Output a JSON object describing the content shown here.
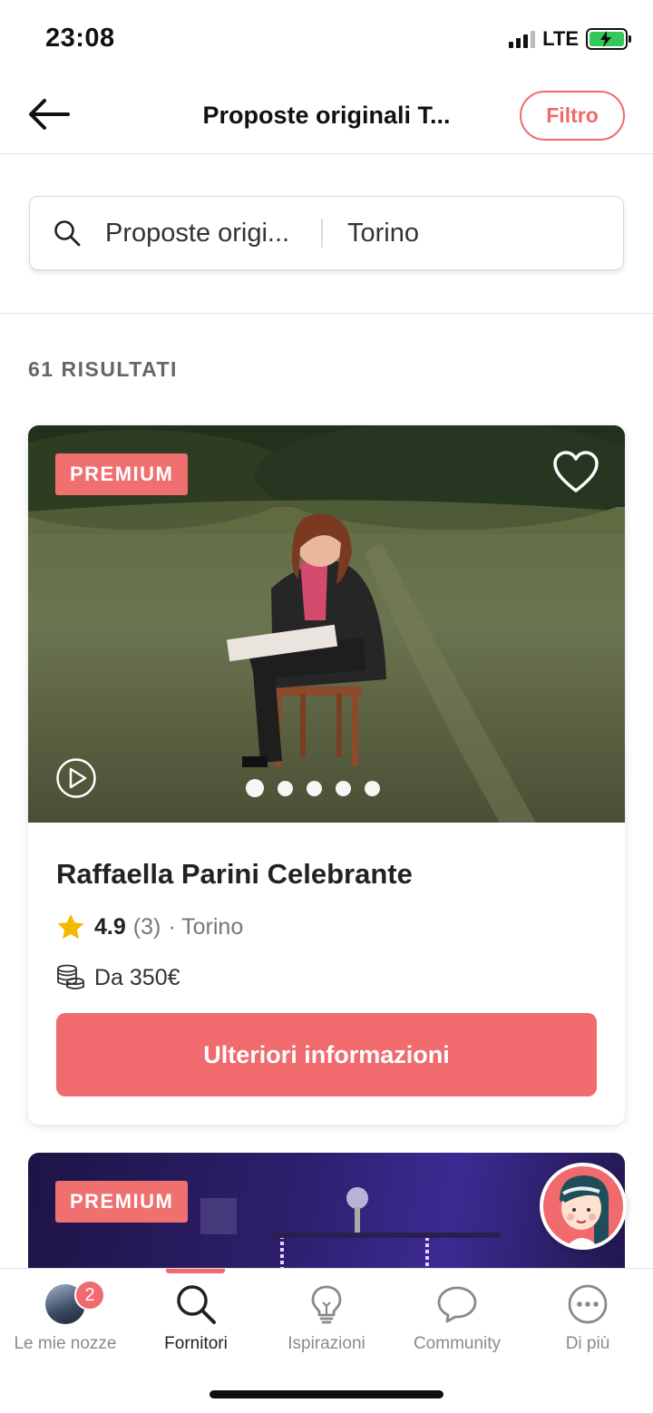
{
  "status_bar": {
    "time": "23:08",
    "network": "LTE"
  },
  "header": {
    "title": "Proposte originali T...",
    "filter_label": "Filtro"
  },
  "search": {
    "query": "Proposte origi...",
    "location": "Torino"
  },
  "results": {
    "count_label": "61 RISULTATI"
  },
  "listings": [
    {
      "badge": "PREMIUM",
      "name": "Raffaella Parini Celebrante",
      "rating": "4.9",
      "reviews": "(3)",
      "location": "· Torino",
      "price": "Da 350€",
      "cta_label": "Ulteriori informazioni",
      "gallery_position": "1 of 5"
    },
    {
      "badge": "PREMIUM"
    }
  ],
  "tabbar": {
    "items": [
      {
        "label": "Le mie nozze",
        "badge": "2",
        "icon": "avatar"
      },
      {
        "label": "Fornitori",
        "icon": "search-icon",
        "active": true
      },
      {
        "label": "Ispirazioni",
        "icon": "lightbulb-icon"
      },
      {
        "label": "Community",
        "icon": "chat-bubble-icon"
      },
      {
        "label": "Di più",
        "icon": "more-icon"
      }
    ]
  },
  "colors": {
    "accent": "#f06a6e",
    "star": "#f5b800",
    "battery": "#34c759"
  }
}
